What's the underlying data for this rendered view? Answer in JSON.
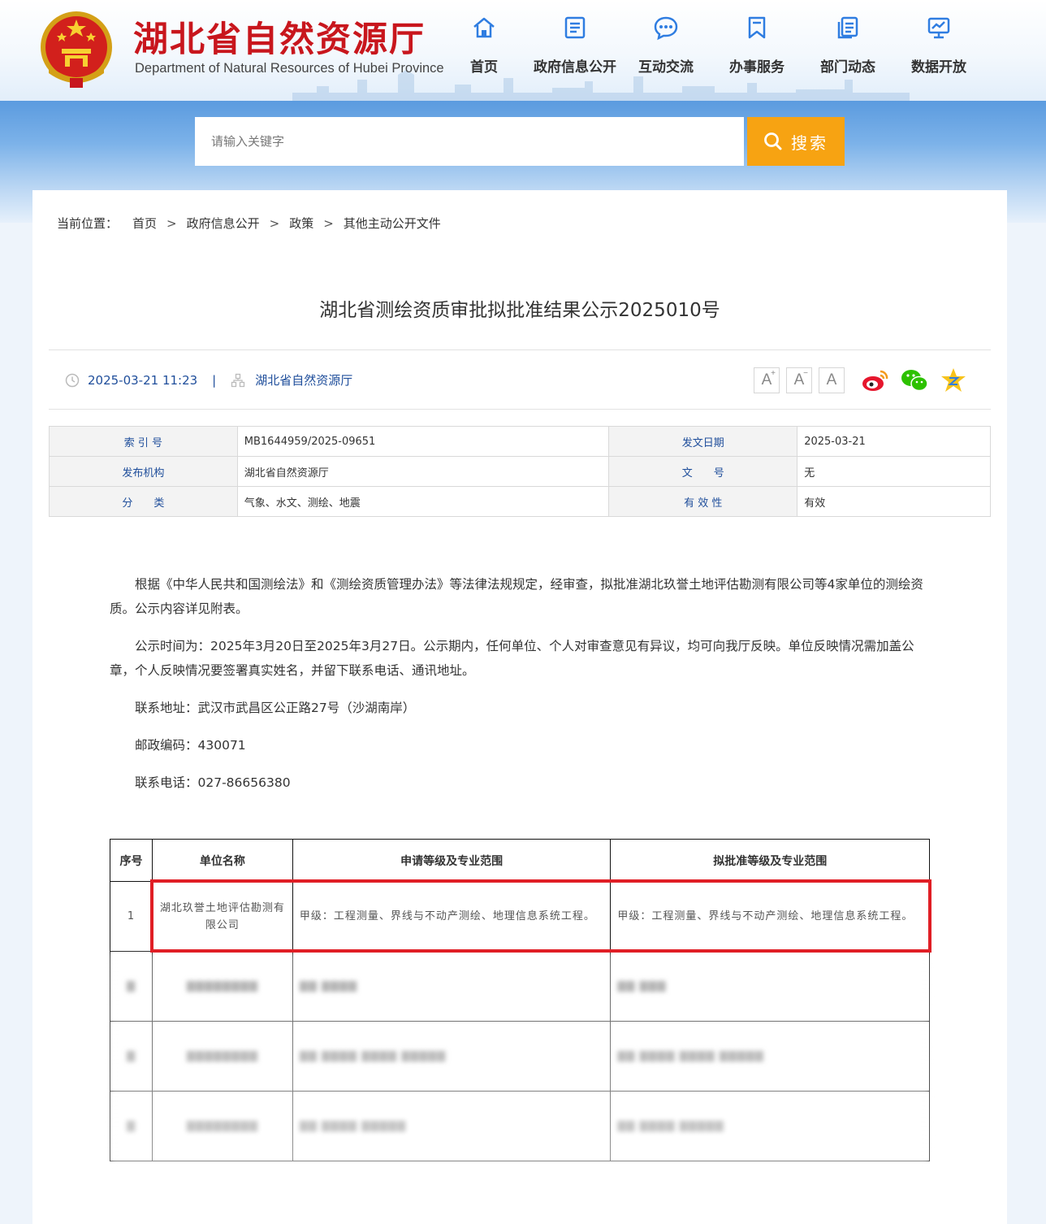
{
  "header": {
    "site_title": "湖北省自然资源厅",
    "site_subtitle": "Department of Natural Resources of Hubei Province",
    "nav": [
      {
        "label": "首页",
        "icon": "home-icon"
      },
      {
        "label": "政府信息公开",
        "icon": "document-icon"
      },
      {
        "label": "互动交流",
        "icon": "chat-icon"
      },
      {
        "label": "办事服务",
        "icon": "bookmark-icon"
      },
      {
        "label": "部门动态",
        "icon": "pages-icon"
      },
      {
        "label": "数据开放",
        "icon": "data-screen-icon"
      }
    ]
  },
  "search": {
    "placeholder": "请输入关键字",
    "button_label": "搜索"
  },
  "breadcrumb": {
    "lead": "当前位置：",
    "items": [
      "首页",
      "政府信息公开",
      "政策",
      "其他主动公开文件"
    ],
    "separator": ">"
  },
  "article": {
    "title": "湖北省测绘资质审批拟批准结果公示2025010号",
    "datetime": "2025-03-21 11:23",
    "publisher": "湖北省自然资源厅",
    "font_buttons": [
      "A+",
      "A-",
      "A"
    ],
    "share": [
      "weibo-icon",
      "wechat-icon",
      "qzone-icon"
    ]
  },
  "info_table": {
    "rows": [
      {
        "k1": "索 引 号",
        "v1": "MB1644959/2025-09651",
        "k2": "发文日期",
        "v2": "2025-03-21"
      },
      {
        "k1": "发布机构",
        "v1": "湖北省自然资源厅",
        "k2": "文　　号",
        "v2": "无"
      },
      {
        "k1": "分　　类",
        "v1": "气象、水文、测绘、地震",
        "k2": "有 效 性",
        "v2": "有效"
      }
    ]
  },
  "body": {
    "p1": "根据《中华人民共和国测绘法》和《测绘资质管理办法》等法律法规规定，经审查，拟批准湖北玖誉土地评估勘测有限公司等4家单位的测绘资质。公示内容详见附表。",
    "p2": "公示时间为：2025年3月20日至2025年3月27日。公示期内，任何单位、个人对审查意见有异议，均可向我厅反映。单位反映情况需加盖公章，个人反映情况要签署真实姓名，并留下联系电话、通讯地址。",
    "p3": "联系地址：武汉市武昌区公正路27号（沙湖南岸）",
    "p4": "邮政编码：430071",
    "p5": "联系电话：027-86656380"
  },
  "result_table": {
    "headers": [
      "序号",
      "单位名称",
      "申请等级及专业范围",
      "拟批准等级及专业范围"
    ],
    "rows": [
      {
        "no": "1",
        "name": "湖北玖誉土地评估勘测有限公司",
        "applied": "甲级：工程测量、界线与不动产测绘、地理信息系统工程。",
        "approved": "甲级：工程测量、界线与不动产测绘、地理信息系统工程。"
      }
    ]
  },
  "colors": {
    "brand_red": "#c8161d",
    "search_orange": "#f7a312",
    "link_blue": "#1f4e9b",
    "highlight_red": "#e01e25"
  }
}
